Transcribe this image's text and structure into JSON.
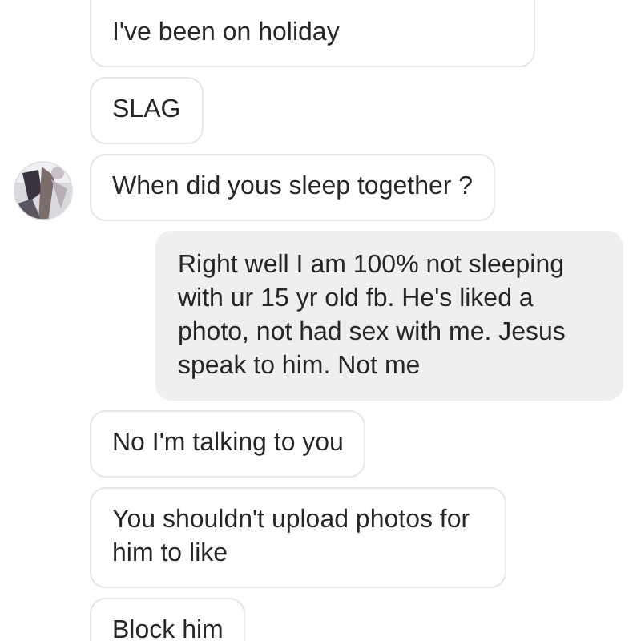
{
  "messages": [
    {
      "kind": "received",
      "text": "I've been on holiday",
      "avatar": false
    },
    {
      "kind": "received",
      "text": "SLAG",
      "avatar": false
    },
    {
      "kind": "received",
      "text": "When did yous sleep together ?",
      "avatar": true
    },
    {
      "kind": "sent",
      "text": "Right well I am 100% not sleeping with ur 15 yr old fb. He's liked a photo, not had sex with me. Jesus speak to him. Not me"
    },
    {
      "kind": "received",
      "text": "No I'm talking to you",
      "avatar": false
    },
    {
      "kind": "received",
      "text": "You shouldn't upload photos for him to like",
      "avatar": false
    },
    {
      "kind": "received",
      "text": "Block him",
      "avatar": false
    }
  ]
}
